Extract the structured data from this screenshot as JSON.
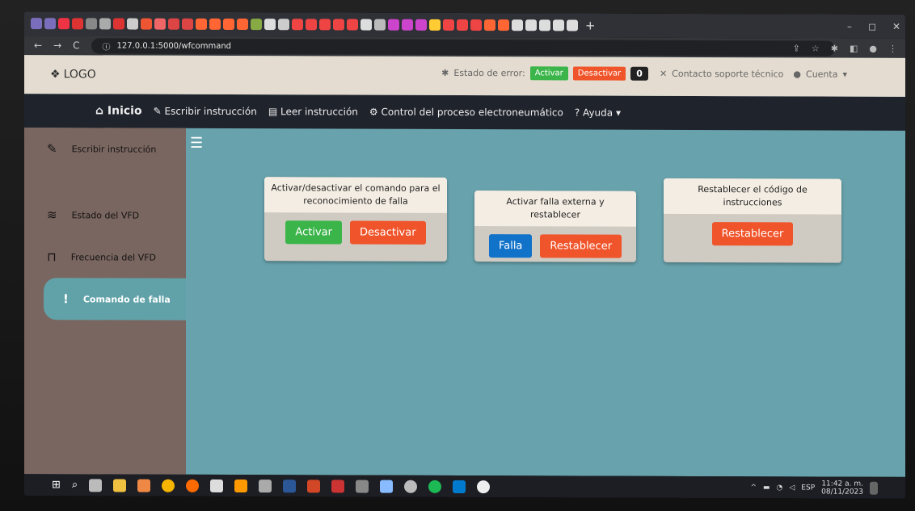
{
  "browser": {
    "url": "127.0.0.1:5000/wfcommand",
    "new_tab": "+",
    "window_controls": [
      "–",
      "◻",
      "✕"
    ]
  },
  "header": {
    "logo": "LOGO",
    "error_label": "Estado de error:",
    "activate": "Activar",
    "deactivate": "Desactivar",
    "error_count": "0",
    "support": "Contacto soporte técnico",
    "account": "Cuenta"
  },
  "nav": {
    "home": "Inicio",
    "write": "Escribir instrucción",
    "read": "Leer instrucción",
    "control": "Control del proceso electroneumático",
    "help": "? Ayuda"
  },
  "sidebar": {
    "items": [
      {
        "label": "Escribir instrucción",
        "icon": "edit-icon"
      },
      {
        "label": "Estado del VFD",
        "icon": "layers-icon"
      },
      {
        "label": "Frecuencia del VFD",
        "icon": "pulse-icon"
      },
      {
        "label": "Comando de falla",
        "icon": "exclamation-icon"
      }
    ]
  },
  "cards": [
    {
      "title": "Activar/desactivar el comando para el reconocimiento de falla",
      "buttons": [
        "Activar",
        "Desactivar"
      ]
    },
    {
      "title": "Activar falla externa y restablecer",
      "buttons": [
        "Falla",
        "Restablecer"
      ]
    },
    {
      "title": "Restablecer el código de instrucciones",
      "buttons": [
        "Restablecer"
      ]
    }
  ],
  "taskbar": {
    "time": "11:42 a. m.",
    "date": "08/11/2023",
    "lang": "ESP"
  },
  "colors": {
    "primary_green": "#3bb54a",
    "danger_orange": "#f0542a",
    "primary_blue": "#1172c9"
  }
}
